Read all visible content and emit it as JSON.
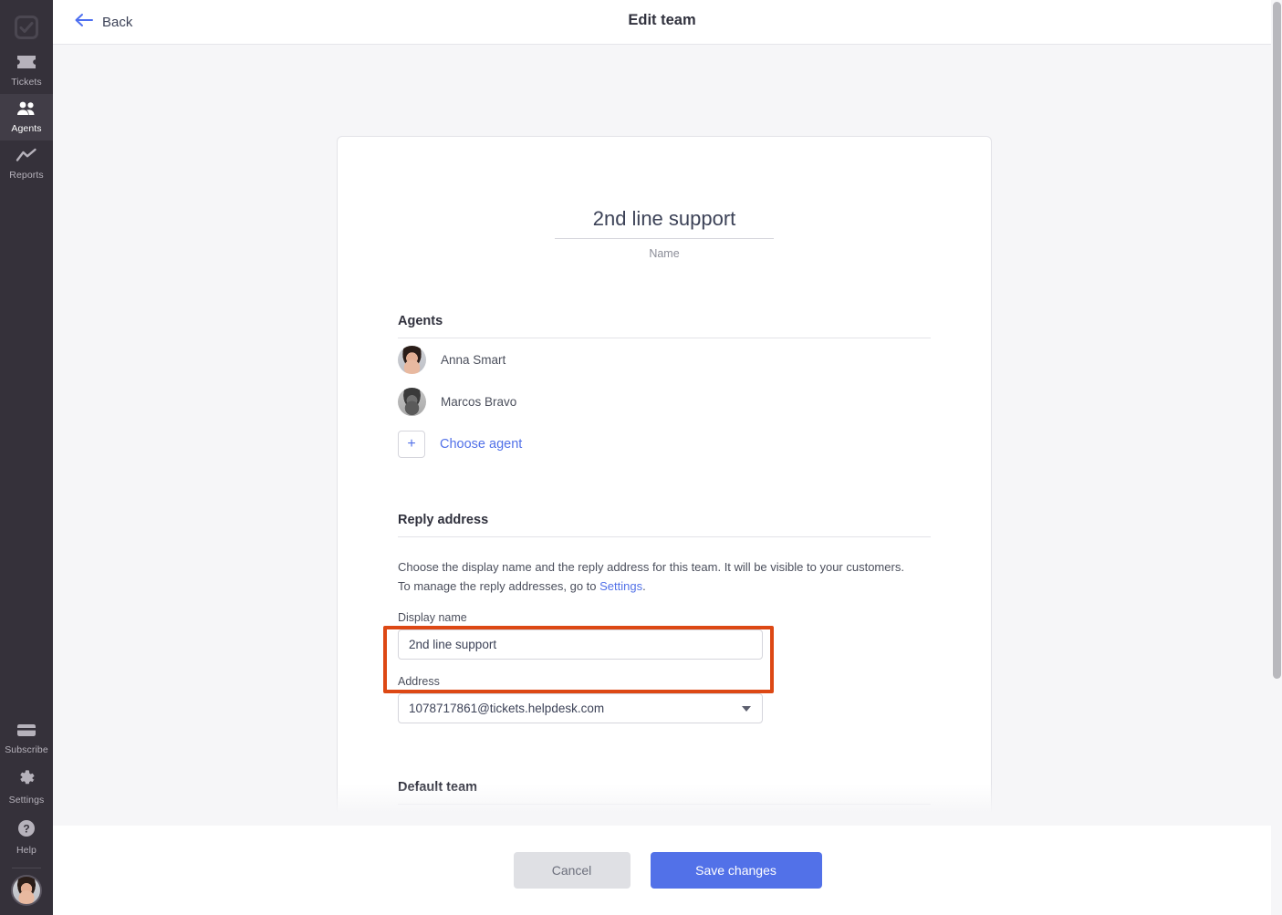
{
  "sidebar": {
    "logo_icon": "checkbox-logo-icon",
    "items": [
      {
        "id": "tickets",
        "label": "Tickets",
        "icon": "ticket-icon",
        "active": false
      },
      {
        "id": "agents",
        "label": "Agents",
        "icon": "people-icon",
        "active": true
      },
      {
        "id": "reports",
        "label": "Reports",
        "icon": "chart-line-icon",
        "active": false
      }
    ],
    "bottom_items": [
      {
        "id": "subscribe",
        "label": "Subscribe",
        "icon": "credit-card-icon"
      },
      {
        "id": "settings",
        "label": "Settings",
        "icon": "gear-icon"
      },
      {
        "id": "help",
        "label": "Help",
        "icon": "question-circle-icon"
      }
    ],
    "avatar_alt": "Anna Smart"
  },
  "topbar": {
    "back_label": "Back",
    "back_icon": "arrow-left-icon",
    "title": "Edit team"
  },
  "card": {
    "team_name": "2nd line support",
    "team_name_caption": "Name",
    "agents": {
      "heading": "Agents",
      "members": [
        {
          "name": "Anna Smart",
          "avatar": "anna"
        },
        {
          "name": "Marcos Bravo",
          "avatar": "marcos"
        }
      ],
      "choose_agent_label": "Choose agent",
      "choose_agent_icon": "plus-icon"
    },
    "reply_address": {
      "heading": "Reply address",
      "description_line1": "Choose the display name and the reply address for this team. It will be visible to your customers.",
      "description_line2_prefix": "To manage the reply addresses, go to ",
      "description_link": "Settings",
      "description_line2_suffix": ".",
      "display_name_label": "Display name",
      "display_name_value": "2nd line support",
      "display_name_placeholder": "Display name",
      "address_label": "Address",
      "address_value": "1078717861@tickets.helpdesk.com",
      "address_caret_icon": "chevron-down-icon"
    },
    "default_team": {
      "heading": "Default team"
    }
  },
  "footer": {
    "cancel_label": "Cancel",
    "save_label": "Save changes"
  },
  "colors": {
    "accent_blue": "#5271e8",
    "highlight_orange": "#dd4814",
    "rail_background": "#35313a",
    "content_background": "#f6f6f8",
    "cancel_grey": "#dfe0e4"
  }
}
